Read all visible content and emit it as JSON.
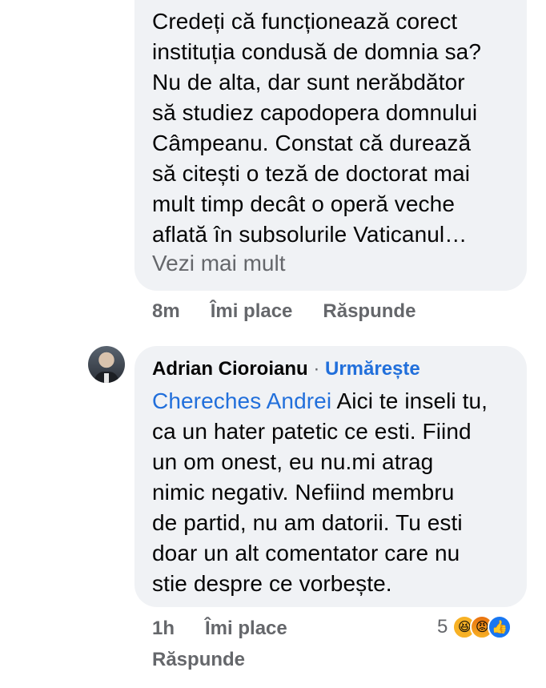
{
  "comment1": {
    "text": "Credeți că funcționează corect\ninstituția condusă de domnia sa?\nNu de alta, dar sunt nerăbdător\nsă studiez capodopera domnului\nCâmpeanu. Constat că durează\nsă citești o teză de doctorat  mai\nmult timp decât o operă veche\naflată în subsolurile Vaticanul…",
    "see_more": "Vezi mai mult",
    "time": "8m",
    "like_label": "Îmi place",
    "reply_label": "Răspunde"
  },
  "comment2": {
    "author": "Adrian Cioroianu",
    "separator": " · ",
    "follow_label": "Urmărește",
    "mention": "Chereches Andrei",
    "text": " Aici te inseli tu,\nca un hater patetic ce esti. Fiind\nun om onest, eu nu.mi atrag\nnimic negativ. Nefiind membru\nde partid, nu am datorii. Tu esti\ndoar un alt comentator care nu\nstie despre ce vorbește.",
    "time": "1h",
    "like_label": "Îmi place",
    "reply_label": "Răspunde",
    "reaction_count": "5",
    "reactions": [
      "haha-icon",
      "angry-icon",
      "like-icon"
    ]
  },
  "colors": {
    "bubble": "#f0f2f5",
    "link": "#216fdb",
    "meta": "#65676b"
  }
}
